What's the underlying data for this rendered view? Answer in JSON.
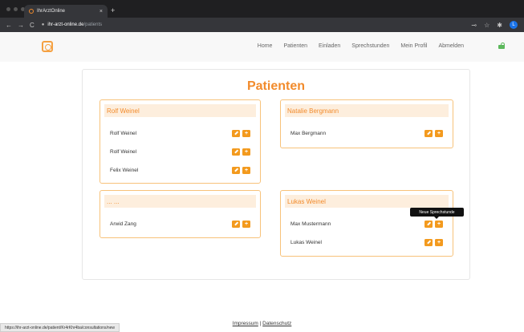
{
  "browser": {
    "tab_title": "IhrArztOnline",
    "tab_close": "×",
    "new_tab": "+",
    "nav_back": "←",
    "nav_forward": "→",
    "nav_reload": "C",
    "url_host": "ihr-arzt-online.de",
    "url_path": "/patients",
    "profile_initial": "L",
    "status_url": "https://ihr-arzt-online.de/patient/Kr4rKhr4ba/consultations/new"
  },
  "navbar": {
    "links": [
      "Home",
      "Patienten",
      "Einladen",
      "Sprechstunden",
      "Mein Profil",
      "Abmelden"
    ]
  },
  "page": {
    "title": "Patienten"
  },
  "cards": [
    {
      "header": "Rolf Weinel",
      "patients": [
        "Rolf Weinel",
        "Rolf Weinel",
        "Felix Weinel"
      ]
    },
    {
      "header": "Natalie Bergmann",
      "patients": [
        "Max Bergmann"
      ]
    },
    {
      "header": "... ...",
      "patients": [
        "Arwid Zang"
      ]
    },
    {
      "header": "Lukas Weinel",
      "patients": [
        "Max Mustermann",
        "Lukas Weinel"
      ]
    }
  ],
  "tooltip": "Neue Sprechstunde",
  "footer": {
    "impressum": "Impressum",
    "separator": "|",
    "datenschutz": "Datenschutz"
  },
  "colors": {
    "accent": "#f28b2c",
    "button": "#f39a1e",
    "card_border": "#f7c27a",
    "card_header_bg": "#fdeedd"
  }
}
